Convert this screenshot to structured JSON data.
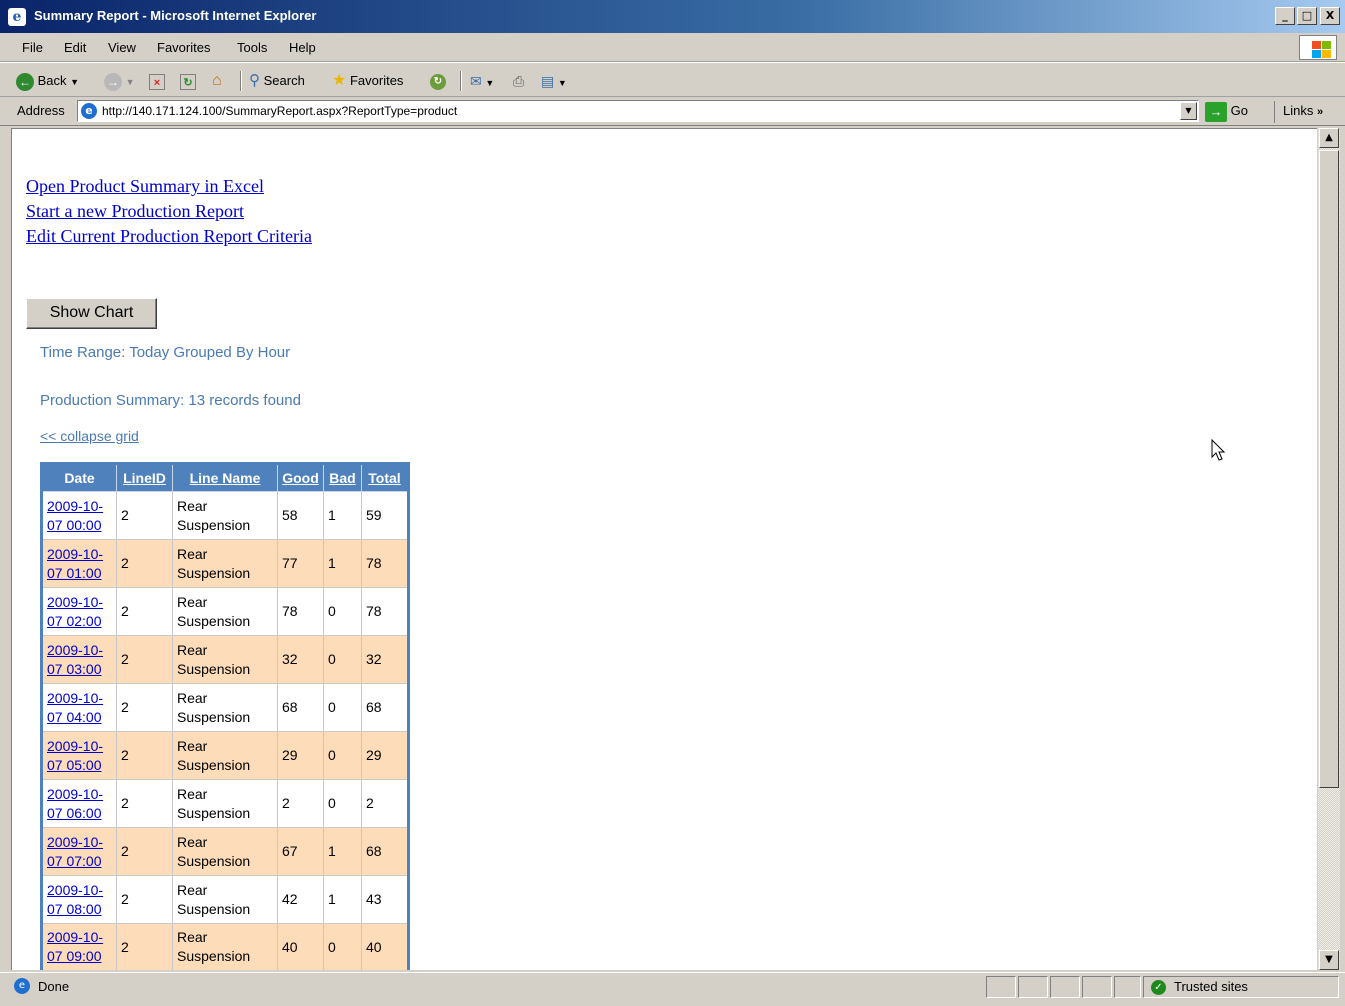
{
  "window": {
    "title": "Summary Report - Microsoft Internet Explorer",
    "minimize": "_",
    "maximize": "□",
    "close": "X"
  },
  "menu": [
    "File",
    "Edit",
    "View",
    "Favorites",
    "Tools",
    "Help"
  ],
  "toolbar": {
    "back_label": "Back",
    "search_label": "Search",
    "favorites_label": "Favorites"
  },
  "address": {
    "label": "Address",
    "url": "http://140.171.124.100/SummaryReport.aspx?ReportType=product",
    "go_label": "Go",
    "links_label": "Links"
  },
  "page": {
    "links": [
      "Open Product Summary in Excel",
      "Start a new Production Report",
      "Edit Current Production Report Criteria"
    ],
    "show_chart_label": "Show Chart",
    "time_range": "Time Range: Today Grouped By Hour",
    "summary": "Production Summary: 13 records found",
    "collapse_label": "<< collapse grid"
  },
  "grid": {
    "headers": [
      "Date",
      "LineID",
      "Line Name",
      "Good",
      "Bad",
      "Total"
    ],
    "rows": [
      {
        "date1": "2009-10-",
        "date2": "07 00:00",
        "line_id": "2",
        "line1": "Rear",
        "line2": "Suspension",
        "good": "58",
        "bad": "1",
        "total": "59"
      },
      {
        "date1": "2009-10-",
        "date2": "07 01:00",
        "line_id": "2",
        "line1": "Rear",
        "line2": "Suspension",
        "good": "77",
        "bad": "1",
        "total": "78"
      },
      {
        "date1": "2009-10-",
        "date2": "07 02:00",
        "line_id": "2",
        "line1": "Rear",
        "line2": "Suspension",
        "good": "78",
        "bad": "0",
        "total": "78"
      },
      {
        "date1": "2009-10-",
        "date2": "07 03:00",
        "line_id": "2",
        "line1": "Rear",
        "line2": "Suspension",
        "good": "32",
        "bad": "0",
        "total": "32"
      },
      {
        "date1": "2009-10-",
        "date2": "07 04:00",
        "line_id": "2",
        "line1": "Rear",
        "line2": "Suspension",
        "good": "68",
        "bad": "0",
        "total": "68"
      },
      {
        "date1": "2009-10-",
        "date2": "07 05:00",
        "line_id": "2",
        "line1": "Rear",
        "line2": "Suspension",
        "good": "29",
        "bad": "0",
        "total": "29"
      },
      {
        "date1": "2009-10-",
        "date2": "07 06:00",
        "line_id": "2",
        "line1": "Rear",
        "line2": "Suspension",
        "good": "2",
        "bad": "0",
        "total": "2"
      },
      {
        "date1": "2009-10-",
        "date2": "07 07:00",
        "line_id": "2",
        "line1": "Rear",
        "line2": "Suspension",
        "good": "67",
        "bad": "1",
        "total": "68"
      },
      {
        "date1": "2009-10-",
        "date2": "07 08:00",
        "line_id": "2",
        "line1": "Rear",
        "line2": "Suspension",
        "good": "42",
        "bad": "1",
        "total": "43"
      },
      {
        "date1": "2009-10-",
        "date2": "07 09:00",
        "line_id": "2",
        "line1": "Rear",
        "line2": "Suspension",
        "good": "40",
        "bad": "0",
        "total": "40"
      }
    ]
  },
  "status": {
    "text": "Done",
    "zone": "Trusted sites"
  },
  "colors": {
    "grid_header": "#4f81bd",
    "alt_row": "#fcdcb9",
    "info_text": "#4a7ab2",
    "link": "#0000cc"
  }
}
